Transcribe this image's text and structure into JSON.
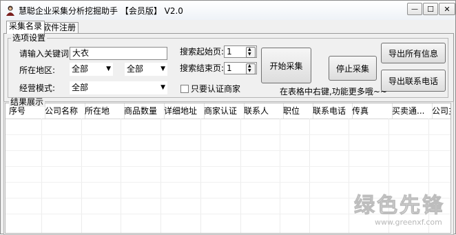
{
  "window": {
    "title": "慧聪企业采集分析挖掘助手 【会员版】 V2.0",
    "controls": {
      "minimize": "—",
      "maximize": "☐",
      "close": "✕"
    }
  },
  "tabs": [
    {
      "label": "采集名录",
      "active": true
    },
    {
      "label": "软件注册",
      "active": false
    }
  ],
  "options": {
    "group_title": "选项设置",
    "keyword_label": "请输入关键词:",
    "keyword_value": "大衣",
    "region_label": "所在地区:",
    "province_value": "全部",
    "city_value": "全部",
    "mode_label": "经营模式:",
    "mode_value": "全部",
    "start_page_label": "搜索起始页:",
    "start_page_value": "1",
    "end_page_label": "搜索结束页:",
    "end_page_value": "1",
    "verified_only_label": "只要认证商家",
    "verified_only_checked": false,
    "start_button": "开始采集",
    "stop_button": "停止采集",
    "export_all_button": "导出所有信息",
    "export_phone_button": "导出联系电话",
    "hint": "在表格中右键,功能更多哦~~"
  },
  "results": {
    "group_title": "结果展示",
    "columns": [
      "序号",
      "公司名称",
      "所在地",
      "商品数量",
      "详细地址",
      "商家认证",
      "联系人",
      "职位",
      "联系电话",
      "传真",
      "买卖通...",
      "公司主"
    ]
  },
  "watermark": {
    "text": "绿色先锋",
    "url": "www.greenxf.com"
  },
  "colors": {
    "window_bg": "#f0f0f0",
    "watermark": "#c8c8c8"
  }
}
